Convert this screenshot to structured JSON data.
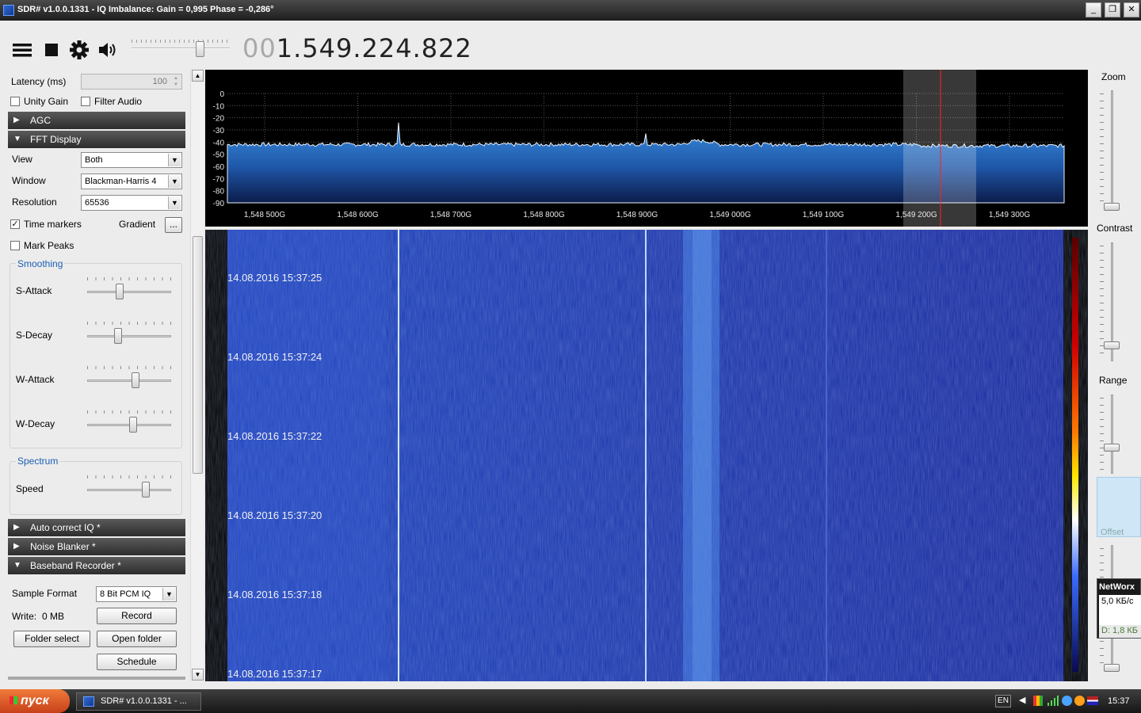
{
  "window": {
    "title": "SDR# v1.0.0.1331 - IQ Imbalance: Gain = 0,995 Phase = -0,286°",
    "minimize": "_",
    "restore": "❐",
    "close": "✕"
  },
  "toolbar": {
    "menu_icon": "hamburger-icon",
    "stop_icon": "stop-icon",
    "settings_icon": "gear-icon",
    "volume_icon": "speaker-icon",
    "volume_level": 0.72,
    "frequency_dim": "00",
    "frequency_main": "1.549.224.822"
  },
  "left_panel": {
    "latency_label": "Latency (ms)",
    "latency_value": "100",
    "unity_gain_label": "Unity Gain",
    "unity_gain_checked": false,
    "filter_audio_label": "Filter Audio",
    "filter_audio_checked": false,
    "sections": {
      "agc": "AGC",
      "fft_display": "FFT Display",
      "auto_correct_iq": "Auto correct IQ *",
      "noise_blanker": "Noise Blanker *",
      "baseband_recorder": "Baseband Recorder *"
    },
    "fft": {
      "view_label": "View",
      "view_value": "Both",
      "window_label": "Window",
      "window_value": "Blackman-Harris 4",
      "resolution_label": "Resolution",
      "resolution_value": "65536",
      "time_markers_label": "Time markers",
      "time_markers_checked": true,
      "gradient_label": "Gradient",
      "gradient_button": "...",
      "mark_peaks_label": "Mark Peaks",
      "mark_peaks_checked": false,
      "smoothing_title": "Smoothing",
      "s_attack_label": "S-Attack",
      "s_decay_label": "S-Decay",
      "w_attack_label": "W-Attack",
      "w_decay_label": "W-Decay",
      "spectrum_title": "Spectrum",
      "speed_label": "Speed",
      "s_attack_level": 0.38,
      "s_decay_level": 0.35,
      "w_attack_level": 0.58,
      "w_decay_level": 0.55,
      "speed_level": 0.72
    },
    "recorder": {
      "sample_format_label": "Sample Format",
      "sample_format_value": "8 Bit PCM IQ",
      "write_label": "Write:",
      "write_value": "0 MB",
      "record_button": "Record",
      "folder_select_button": "Folder select",
      "open_folder_button": "Open folder",
      "schedule_button": "Schedule"
    }
  },
  "spectrum": {
    "y_ticks": [
      "0",
      "-10",
      "-20",
      "-30",
      "-40",
      "-50",
      "-60",
      "-70",
      "-80",
      "-90"
    ],
    "x_ticks": [
      "1,548 500G",
      "1,548 600G",
      "1,548 700G",
      "1,548 800G",
      "1,548 900G",
      "1,549 000G",
      "1,549 100G",
      "1,549 200G",
      "1,549 300G"
    ]
  },
  "waterfall": {
    "timestamps": [
      "14.08.2016 15:37:25",
      "14.08.2016 15:37:24",
      "14.08.2016 15:37:22",
      "14.08.2016 15:37:20",
      "14.08.2016 15:37:18",
      "14.08.2016 15:37:17"
    ]
  },
  "right_panel": {
    "zoom_label": "Zoom",
    "contrast_label": "Contrast",
    "range_label": "Range",
    "offset_label": "Offset",
    "networx_title": "NetWorx",
    "networx_speed": "5,0 КБ/с",
    "networx_download": "D: 1,8 КБ"
  },
  "taskbar": {
    "start_label": "пуск",
    "task_label": "SDR# v1.0.0.1331 - ...",
    "lang": "EN",
    "clock": "15:37"
  },
  "colors": {
    "spectrum_fill": "#2f7fd0",
    "waterfall_base": "#1a2fa8",
    "marker": "#ff2020"
  }
}
